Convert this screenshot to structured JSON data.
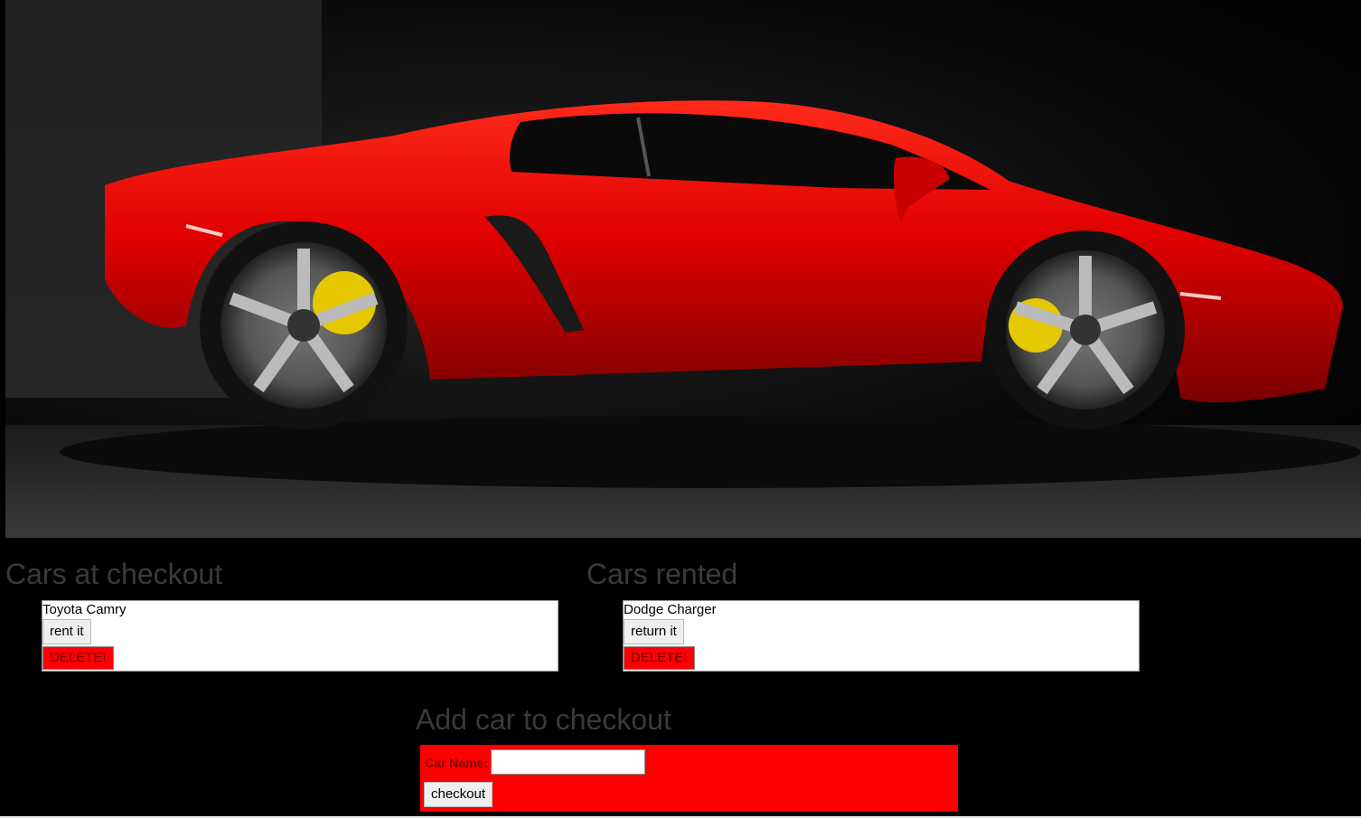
{
  "hero": {
    "image_alt": "Red sports car",
    "body_color": "#e00000",
    "caliper_color": "#e6c800"
  },
  "checkout": {
    "title": "Cars at checkout",
    "items": [
      {
        "name": "Toyota Camry",
        "action_label": "rent it",
        "delete_label": "DELETE!"
      }
    ]
  },
  "rented": {
    "title": "Cars rented",
    "items": [
      {
        "name": "Dodge Charger",
        "action_label": "return it",
        "delete_label": "DELETE!"
      }
    ]
  },
  "add_form": {
    "title": "Add car to checkout",
    "name_label": "Car Name:",
    "name_value": "",
    "submit_label": "checkout",
    "background_color": "#ff0000"
  }
}
